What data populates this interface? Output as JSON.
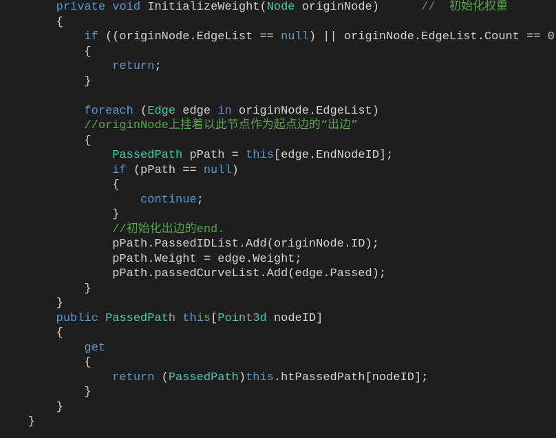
{
  "code": {
    "tokens": [
      [
        [
          "plain",
          "        "
        ],
        [
          "kw",
          "private"
        ],
        [
          "plain",
          " "
        ],
        [
          "kw",
          "void"
        ],
        [
          "plain",
          " InitializeWeight("
        ],
        [
          "type",
          "Node"
        ],
        [
          "plain",
          " originNode)      "
        ],
        [
          "cmt",
          "//  初始化权重"
        ]
      ],
      [
        [
          "plain",
          "        {"
        ]
      ],
      [
        [
          "plain",
          "            "
        ],
        [
          "kw",
          "if"
        ],
        [
          "plain",
          " ((originNode.EdgeList == "
        ],
        [
          "kw",
          "null"
        ],
        [
          "plain",
          ") || originNode.EdgeList.Count == "
        ],
        [
          "num",
          "0"
        ],
        [
          "plain",
          ")"
        ]
      ],
      [
        [
          "plain",
          "            {"
        ]
      ],
      [
        [
          "plain",
          "                "
        ],
        [
          "kw",
          "return"
        ],
        [
          "plain",
          ";"
        ]
      ],
      [
        [
          "plain",
          "            }"
        ]
      ],
      [
        [
          "plain",
          " "
        ]
      ],
      [
        [
          "plain",
          "            "
        ],
        [
          "kw",
          "foreach"
        ],
        [
          "plain",
          " ("
        ],
        [
          "type",
          "Edge"
        ],
        [
          "plain",
          " edge "
        ],
        [
          "kw",
          "in"
        ],
        [
          "plain",
          " originNode.EdgeList)"
        ]
      ],
      [
        [
          "plain",
          "            "
        ],
        [
          "cmt",
          "//originNode上挂着以此节点作为起点边的“出边”"
        ]
      ],
      [
        [
          "plain",
          "            {"
        ]
      ],
      [
        [
          "plain",
          "                "
        ],
        [
          "type",
          "PassedPath"
        ],
        [
          "plain",
          " pPath = "
        ],
        [
          "kw",
          "this"
        ],
        [
          "plain",
          "[edge.EndNodeID];"
        ]
      ],
      [
        [
          "plain",
          "                "
        ],
        [
          "kw",
          "if"
        ],
        [
          "plain",
          " (pPath == "
        ],
        [
          "kw",
          "null"
        ],
        [
          "plain",
          ")"
        ]
      ],
      [
        [
          "plain",
          "                {"
        ]
      ],
      [
        [
          "plain",
          "                    "
        ],
        [
          "kw",
          "continue"
        ],
        [
          "plain",
          ";"
        ]
      ],
      [
        [
          "plain",
          "                }"
        ]
      ],
      [
        [
          "plain",
          "                "
        ],
        [
          "cmt",
          "//初始化出边的end."
        ]
      ],
      [
        [
          "plain",
          "                pPath.PassedIDList.Add(originNode.ID);"
        ]
      ],
      [
        [
          "plain",
          "                pPath.Weight = edge.Weight;"
        ]
      ],
      [
        [
          "plain",
          "                pPath.passedCurveList.Add(edge.Passed);"
        ]
      ],
      [
        [
          "plain",
          "            }"
        ]
      ],
      [
        [
          "plain",
          "        }"
        ]
      ],
      [
        [
          "plain",
          "        "
        ],
        [
          "kw",
          "public"
        ],
        [
          "plain",
          " "
        ],
        [
          "type",
          "PassedPath"
        ],
        [
          "plain",
          " "
        ],
        [
          "kw",
          "this"
        ],
        [
          "plain",
          "["
        ],
        [
          "type",
          "Point3d"
        ],
        [
          "plain",
          " nodeID]"
        ]
      ],
      [
        [
          "plain",
          "        {"
        ]
      ],
      [
        [
          "plain",
          "            "
        ],
        [
          "kw",
          "get"
        ]
      ],
      [
        [
          "plain",
          "            {"
        ]
      ],
      [
        [
          "plain",
          "                "
        ],
        [
          "kw",
          "return"
        ],
        [
          "plain",
          " ("
        ],
        [
          "type",
          "PassedPath"
        ],
        [
          "plain",
          ")"
        ],
        [
          "kw",
          "this"
        ],
        [
          "plain",
          ".htPassedPath[nodeID];"
        ]
      ],
      [
        [
          "plain",
          "            }"
        ]
      ],
      [
        [
          "plain",
          "        }"
        ]
      ],
      [
        [
          "plain",
          "    }"
        ]
      ]
    ]
  }
}
